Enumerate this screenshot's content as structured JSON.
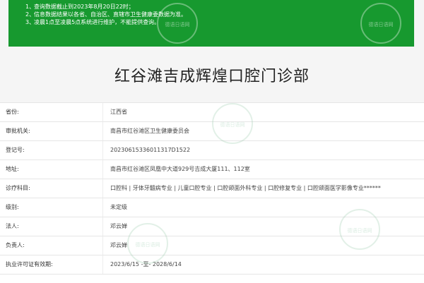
{
  "notice": {
    "lines": [
      {
        "num": "1、",
        "text": "查询数据截止到2023年8月20日22时；"
      },
      {
        "num": "2、",
        "text": "信息数据结果以各省、自治区、直辖市卫生健康委数据为准。"
      },
      {
        "num": "3、",
        "text": "凌晨1点至凌晨5点系统进行维护，不能提供查询。"
      }
    ]
  },
  "watermark": {
    "text": "德语日语网"
  },
  "title": "红谷滩吉成辉煌口腔门诊部",
  "fields": [
    {
      "label": "省份:",
      "value": "江西省"
    },
    {
      "label": "审批机关:",
      "value": "南昌市红谷滩区卫生健康委员会"
    },
    {
      "label": "登记号:",
      "value": "20230615336011317D1522"
    },
    {
      "label": "地址:",
      "value": "南昌市红谷滩区凤凰中大道929号吉成大厦111、112室"
    },
    {
      "label": "诊疗科目:",
      "value": "口腔科 | 牙体牙髓病专业 | 儿童口腔专业 | 口腔颌面外科专业 | 口腔修复专业 | 口腔颌面医学影像专业******"
    },
    {
      "label": "级别:",
      "value": "未定级"
    },
    {
      "label": "法人:",
      "value": "邓云婵"
    },
    {
      "label": "负责人:",
      "value": "邓云婵"
    },
    {
      "label": "执业许可证有效期:",
      "value": "2023/6/15 -至- 2028/6/14"
    }
  ]
}
